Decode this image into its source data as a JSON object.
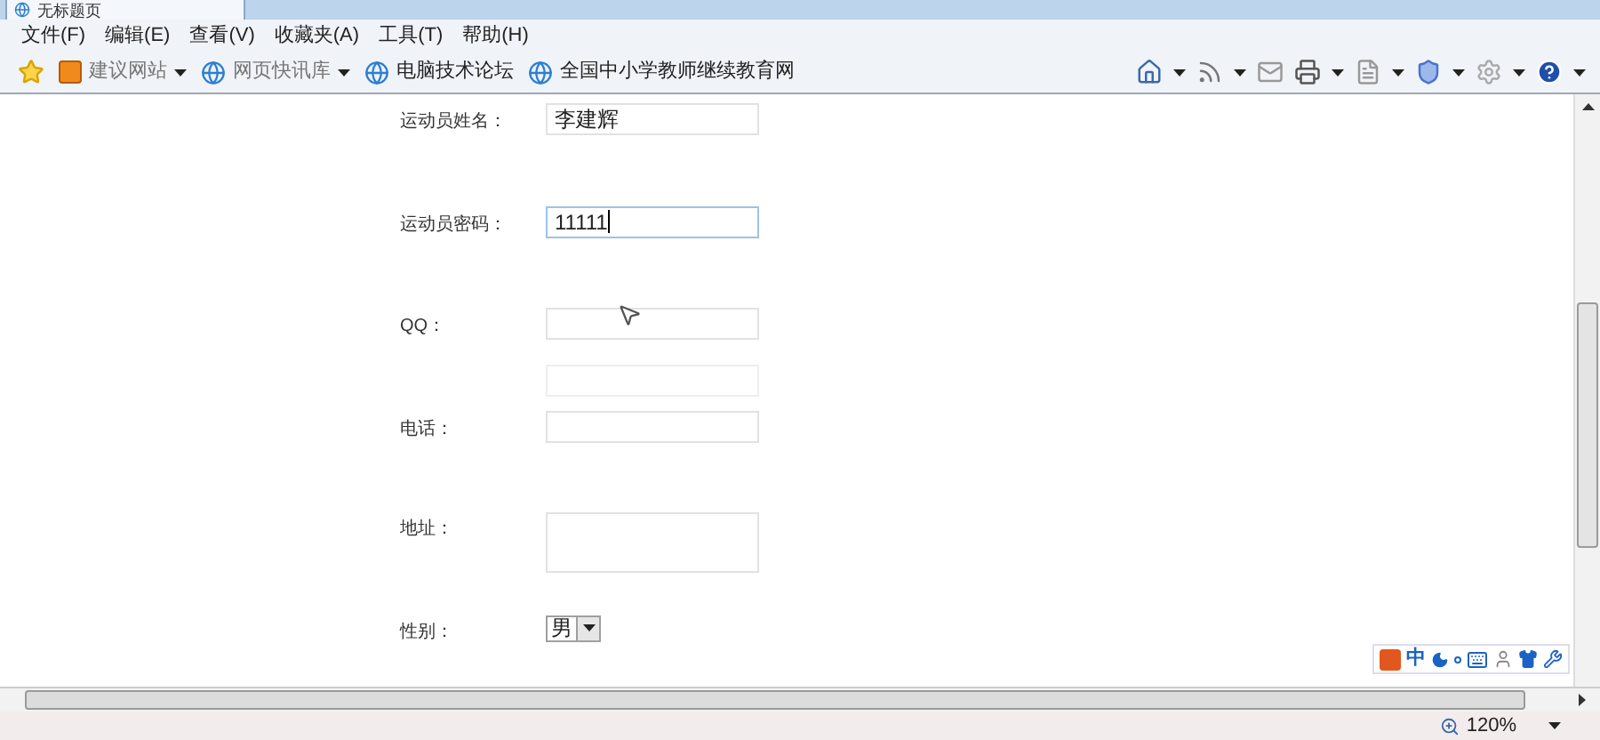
{
  "tab": {
    "title": "无标题页"
  },
  "menu": [
    "文件(F)",
    "编辑(E)",
    "查看(V)",
    "收藏夹(A)",
    "工具(T)",
    "帮助(H)"
  ],
  "favorites": [
    {
      "label": "建议网站",
      "kind": "slice",
      "dropdown": true
    },
    {
      "label": "网页快讯库",
      "kind": "page",
      "dropdown": true
    },
    {
      "label": "电脑技术论坛",
      "kind": "page",
      "dropdown": false
    },
    {
      "label": "全国中小学教师继续教育网",
      "kind": "page",
      "dropdown": false
    }
  ],
  "form": {
    "rows": [
      {
        "label": "运动员姓名：",
        "kind": "text",
        "value": "李建辉",
        "focused": false
      },
      {
        "label": "运动员密码：",
        "kind": "text",
        "value": "11111",
        "focused": true
      },
      {
        "label": "QQ：",
        "kind": "text_pair",
        "focused": false
      },
      {
        "label": "电话：",
        "kind": "text",
        "focused": false
      },
      {
        "label": "地址：",
        "kind": "textarea",
        "focused": false
      },
      {
        "label": "性别：",
        "kind": "select",
        "value": "男",
        "focused": false
      }
    ]
  },
  "ime": {
    "mode": "中"
  },
  "status": {
    "zoom": "120%"
  }
}
